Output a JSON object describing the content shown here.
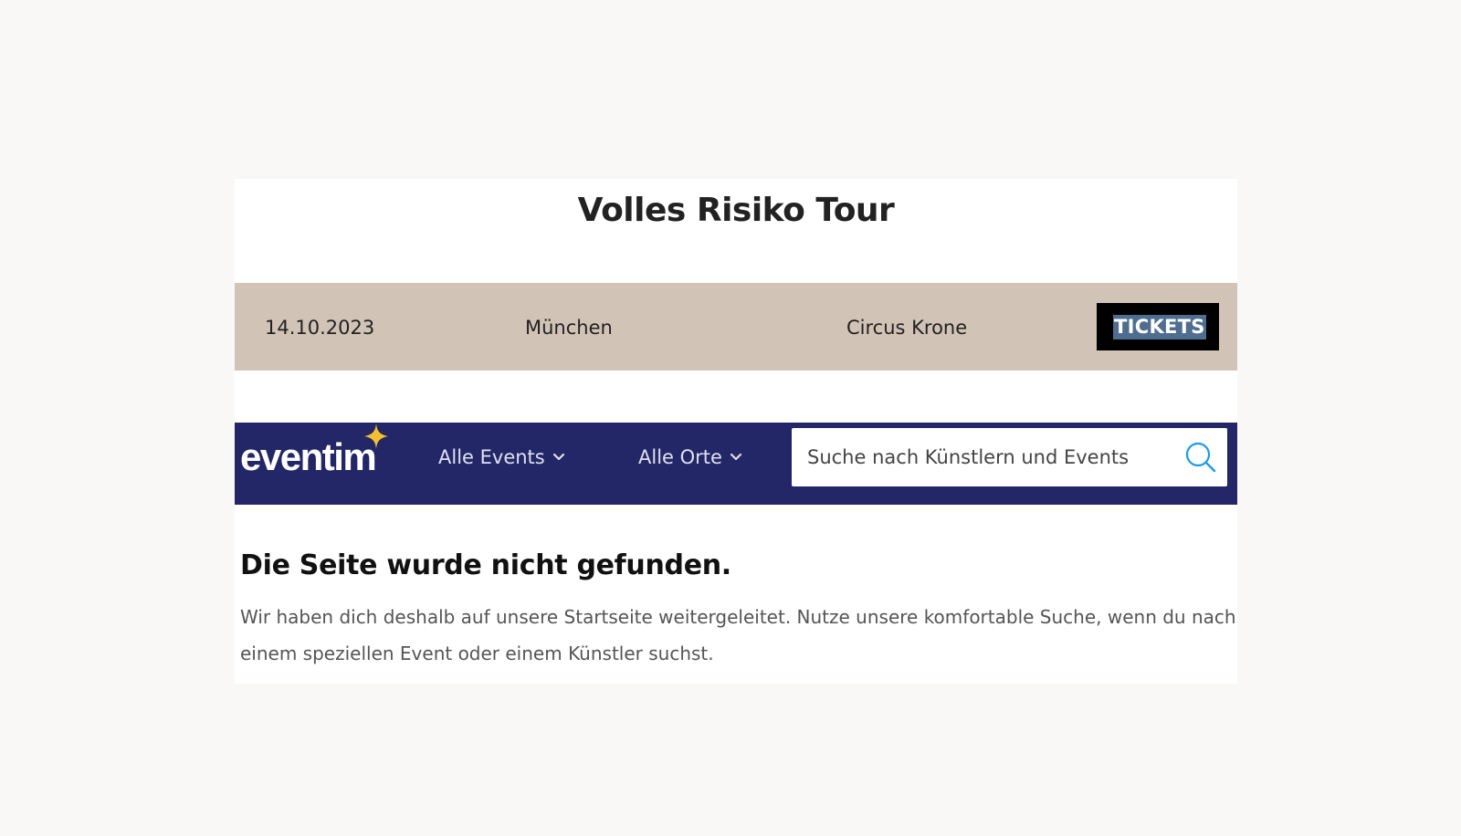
{
  "tour": {
    "title": "Volles Risiko Tour"
  },
  "event": {
    "date": "14.10.2023",
    "city": "München",
    "venue": "Circus Krone",
    "tickets_label": "TICKETS"
  },
  "eventim": {
    "logo_text": "eventim",
    "nav": [
      {
        "label": "Alle Events"
      },
      {
        "label": "Alle Orte"
      }
    ],
    "search": {
      "placeholder": "Suche nach Künstlern und Events"
    },
    "error": {
      "title": "Die Seite wurde nicht gefunden.",
      "message": "Wir haben dich deshalb auf unsere Startseite weitergeleitet. Nutze unsere komfortable Suche, wenn du nach einem speziellen Event oder einem Künstler suchst."
    }
  },
  "colors": {
    "page_background": "#faf8f7",
    "event_row": "#d2c3b7",
    "nav_bar": "#232767",
    "tickets_button": "#000000",
    "tickets_highlight": "#4f6d8f",
    "logo_star": "#f5c030",
    "search_icon": "#1a9be6"
  },
  "icons": [
    "star-icon",
    "chevron-down-icon",
    "search-icon"
  ]
}
